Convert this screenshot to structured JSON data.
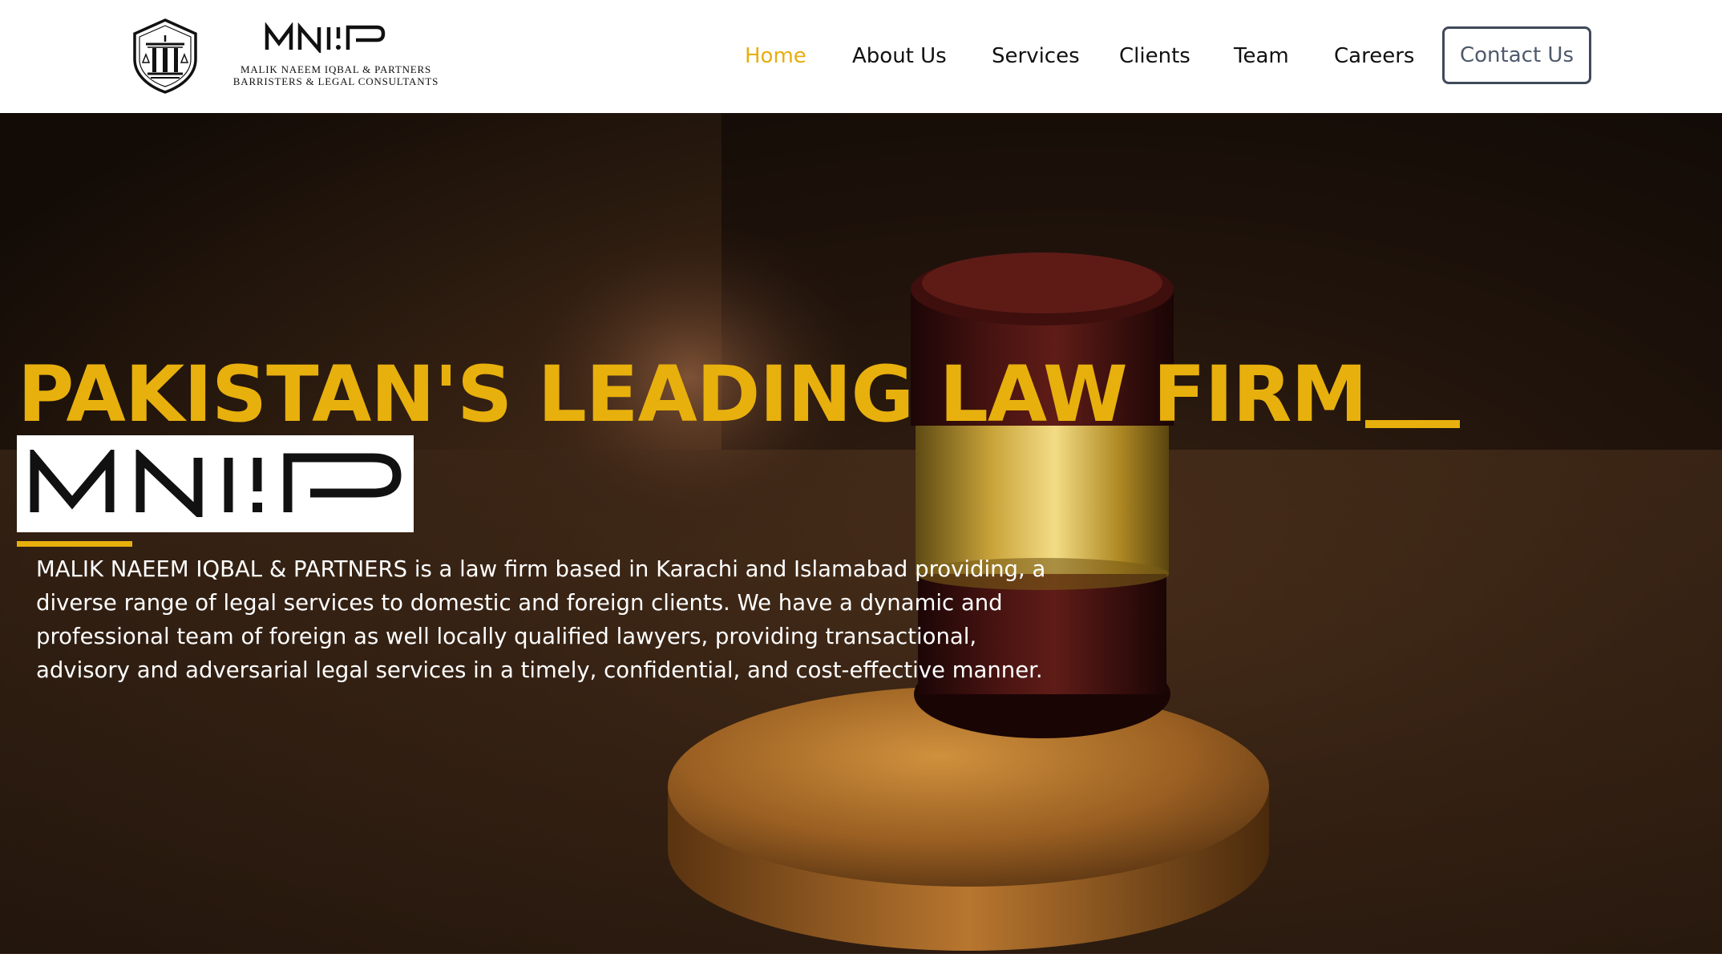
{
  "brand": {
    "wordmark": "MNIP",
    "name_line": "MALIK NAEEM IQBAL & PARTNERS",
    "tagline": "BARRISTERS & LEGAL CONSULTANTS"
  },
  "nav": {
    "items": [
      {
        "label": "Home",
        "active": true
      },
      {
        "label": "About Us",
        "active": false
      },
      {
        "label": "Services",
        "active": false
      },
      {
        "label": "Clients",
        "active": false
      },
      {
        "label": "Team",
        "active": false
      },
      {
        "label": "Careers",
        "active": false
      }
    ],
    "contact_label": "Contact Us"
  },
  "hero": {
    "title": "PAKISTAN'S LEADING LAW FIRM",
    "badge_wordmark": "MNIP",
    "description": "MALIK NAEEM IQBAL & PARTNERS is a law firm based in Karachi and Islamabad providing, a diverse range of legal services to domestic and foreign clients. We have a dynamic and professional team of foreign as well locally qualified lawyers, providing transactional, advisory and adversarial legal services in a timely, confidential, and cost-effective manner.",
    "background_image": "judge-gavel-photo"
  },
  "colors": {
    "accent": "#e8b00d",
    "text_dark": "#111111",
    "button_border": "#3f4a5a",
    "hero_text": "#ffffff"
  },
  "icons": {
    "logo": "scales-of-justice-shield-icon"
  }
}
